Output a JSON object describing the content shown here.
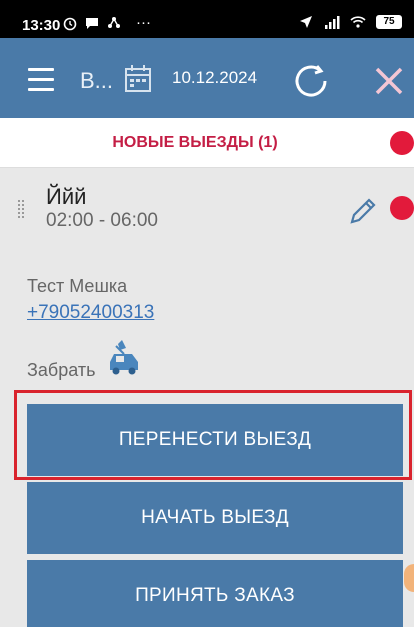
{
  "status_bar": {
    "time": "13:30",
    "more": "···",
    "battery": "75"
  },
  "app_bar": {
    "title": "В...",
    "date": "10.12.2024"
  },
  "section": {
    "title": "НОВЫЕ ВЫЕЗДЫ (1)",
    "dot_color": "#e21a3b"
  },
  "order": {
    "name": "Ййй",
    "time_range": "02:00 - 06:00",
    "client_name": "Тест Мешка",
    "client_phone": "+79052400313",
    "pickup_label": "Забрать"
  },
  "buttons": {
    "reschedule": "ПЕРЕНЕСТИ ВЫЕЗД",
    "start": "НАЧАТЬ ВЫЕЗД",
    "accept": "ПРИНЯТЬ ЗАКАЗ"
  },
  "colors": {
    "accent": "#4a7aa8",
    "highlight": "#d9232d",
    "section_title": "#c41e45"
  }
}
